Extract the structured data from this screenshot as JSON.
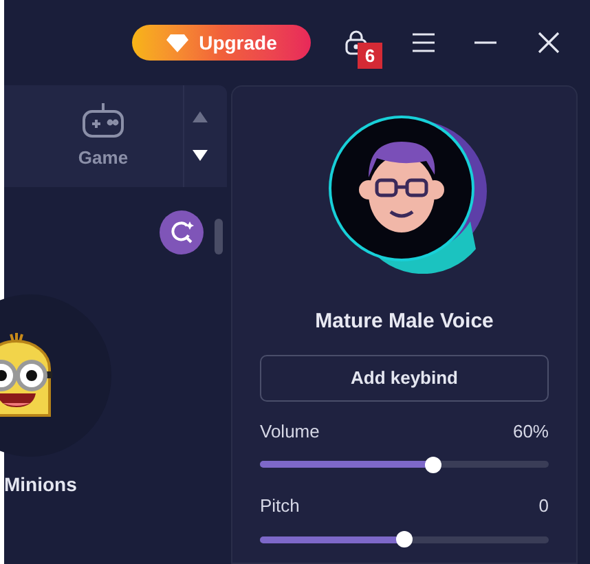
{
  "title_bar": {
    "upgrade_button": "Upgrade",
    "callout_number": "6"
  },
  "categories": [
    {
      "label": "Game",
      "selected": false
    }
  ],
  "voices": [
    {
      "name": "Minions",
      "selected": false
    }
  ],
  "selected_voice": {
    "name": "Mature Male Voice",
    "keybind_button": "Add keybind"
  },
  "sliders": [
    {
      "label": "Volume",
      "reading": "60%",
      "level": 0.6
    },
    {
      "label": "Pitch",
      "reading": "0",
      "level": 0.5
    }
  ]
}
